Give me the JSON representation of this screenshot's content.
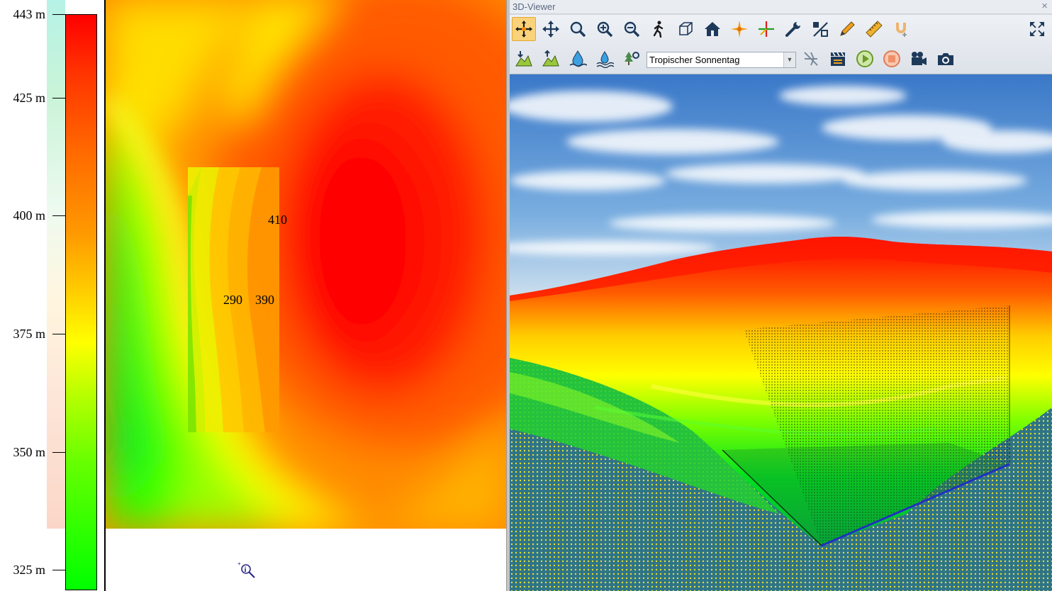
{
  "legend": {
    "labels": [
      {
        "text": "443 m",
        "value": 443
      },
      {
        "text": "425 m",
        "value": 425
      },
      {
        "text": "400 m",
        "value": 400
      },
      {
        "text": "375 m",
        "value": 375
      },
      {
        "text": "350 m",
        "value": 350
      },
      {
        "text": "325 m",
        "value": 325
      }
    ],
    "color_low": "#00ff00",
    "color_high": "#ff0000"
  },
  "map": {
    "contour_labels": [
      "410",
      "290",
      "390"
    ],
    "cursor_icon": "info-magnifier-icon"
  },
  "viewer": {
    "title": "3D-Viewer",
    "close_glyph": "×",
    "toolbar_row1": [
      {
        "name": "pan-crosshair-icon",
        "active": true
      },
      {
        "name": "move-arrows-icon"
      },
      {
        "name": "zoom-icon"
      },
      {
        "name": "zoom-in-icon"
      },
      {
        "name": "zoom-out-icon"
      },
      {
        "name": "walk-icon"
      },
      {
        "name": "box-icon"
      },
      {
        "name": "home-icon"
      },
      {
        "name": "orange-star-icon"
      },
      {
        "name": "axes-cross-icon"
      },
      {
        "name": "wrench-icon"
      },
      {
        "name": "percent-layers-icon"
      },
      {
        "name": "pencil-icon"
      },
      {
        "name": "ruler-icon"
      },
      {
        "name": "magnet-icon"
      }
    ],
    "toolbar_row2": [
      {
        "name": "terrain-down-icon"
      },
      {
        "name": "terrain-up-icon"
      },
      {
        "name": "water-drop-icon"
      },
      {
        "name": "water-level-icon"
      },
      {
        "name": "tree-settings-icon"
      }
    ],
    "toolbar_row2_after": [
      {
        "name": "disabled-plane-icon"
      },
      {
        "name": "clapperboard-icon"
      },
      {
        "name": "play-icon"
      },
      {
        "name": "stop-icon"
      },
      {
        "name": "video-camera-icon"
      },
      {
        "name": "photo-camera-icon"
      }
    ],
    "fullscreen_icon": "expand-arrows-icon",
    "sky_preset": "Tropischer Sonnentag"
  }
}
